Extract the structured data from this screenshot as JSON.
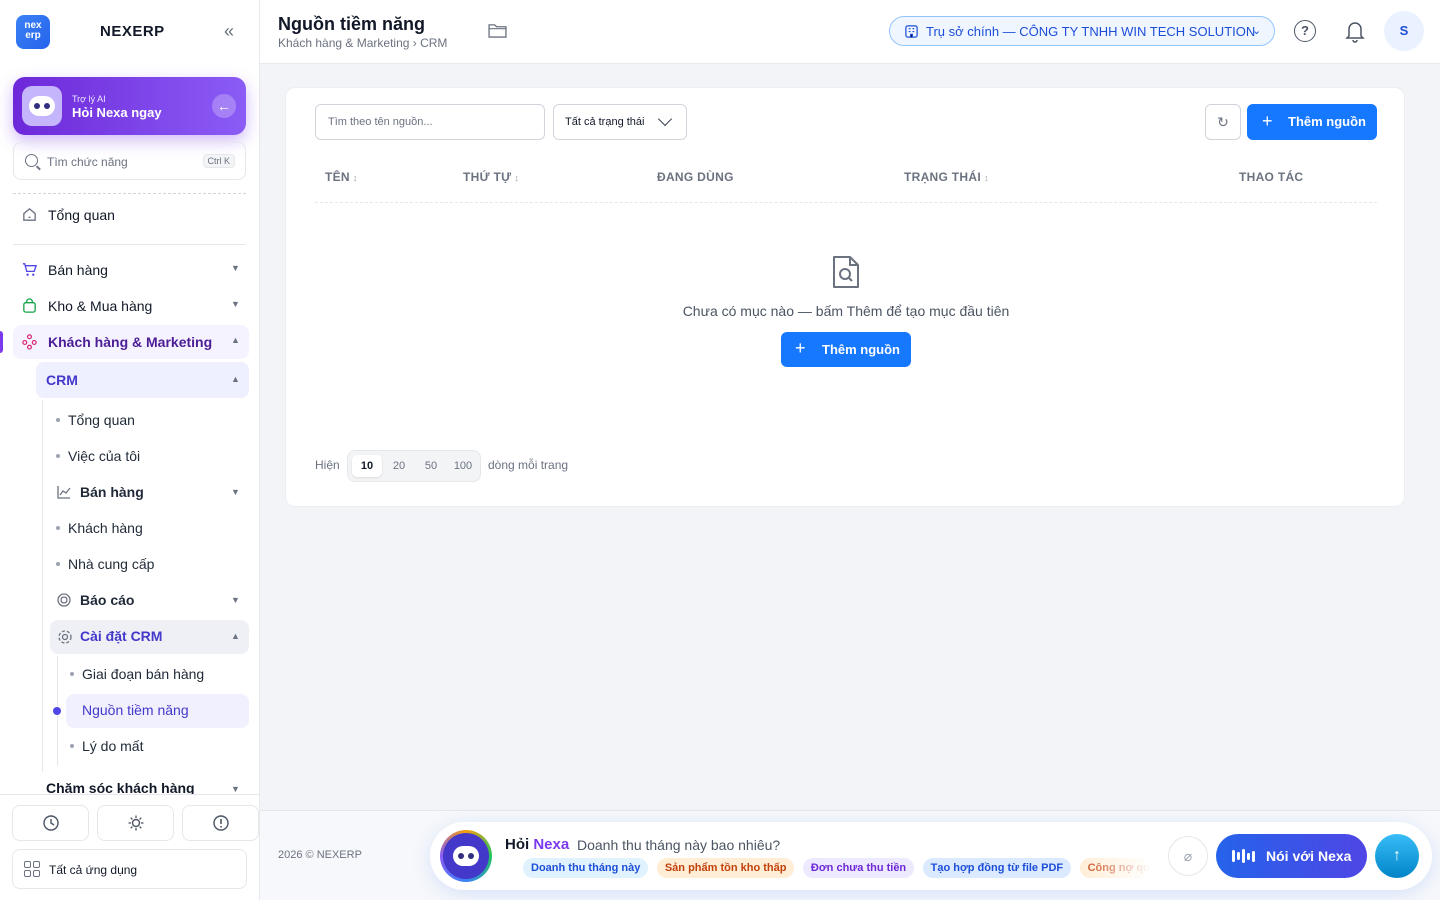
{
  "brand": {
    "logo_text": "nex erp",
    "name": "NEXERP"
  },
  "ai_card": {
    "subtitle": "Trợ lý AI",
    "title": "Hỏi Nexa ngay"
  },
  "side_search": {
    "placeholder": "Tìm chức năng",
    "shortcut": "Ctrl K"
  },
  "sidebar": {
    "overview": "Tổng quan",
    "groups": [
      {
        "label": "Bán hàng",
        "icon": "cart-icon"
      },
      {
        "label": "Kho & Mua hàng",
        "icon": "bag-icon"
      },
      {
        "label": "Khách hàng & Marketing",
        "icon": "users-network-icon"
      }
    ],
    "crm": {
      "label": "CRM",
      "items": [
        {
          "label": "Tổng quan"
        },
        {
          "label": "Việc của tôi"
        },
        {
          "label": "Bán hàng"
        },
        {
          "label": "Khách hàng"
        },
        {
          "label": "Nhà cung cấp"
        },
        {
          "label": "Báo cáo"
        },
        {
          "label": "Cài đặt CRM"
        }
      ],
      "settings_items": [
        {
          "label": "Giai đoạn bán hàng"
        },
        {
          "label": "Nguồn tiềm năng"
        },
        {
          "label": "Lý do mất"
        }
      ]
    },
    "cham_soc": "Chăm sóc khách hàng",
    "all_apps": "Tất cả ứng dụng"
  },
  "header": {
    "title": "Nguồn tiềm năng",
    "breadcrumb": "Khách hàng & Marketing › CRM",
    "company": "Trụ sở chính — CÔNG TY TNHH WIN TECH SOLUTION",
    "avatar": "S"
  },
  "toolbar": {
    "search_placeholder": "Tìm theo tên nguồn...",
    "status_filter": "Tất cả trạng thái",
    "add_label": "Thêm nguồn"
  },
  "table": {
    "columns": [
      "TÊN",
      "THỨ TỰ",
      "ĐANG DÙNG",
      "TRẠNG THÁI",
      "THAO TÁC"
    ],
    "sortable": [
      true,
      true,
      false,
      true,
      false
    ],
    "rows": []
  },
  "empty_state": {
    "message": "Chưa có mục nào — bấm Thêm để tạo mục đầu tiên",
    "button": "Thêm nguồn"
  },
  "pagination": {
    "prefix": "Hiện",
    "options": [
      "10",
      "20",
      "50",
      "100"
    ],
    "selected": "10",
    "suffix": "dòng mỗi trang"
  },
  "footer": {
    "copyright": "2026 © NEXERP"
  },
  "ask_bar": {
    "hoi": "Hỏi",
    "nexa": "Nexa",
    "placeholder": "Doanh thu tháng này bao nhiêu?",
    "chips": [
      "Doanh thu tháng này",
      "Sản phẩm tồn kho thấp",
      "Đơn chưa thu tiền",
      "Tạo hợp đồng từ file PDF",
      "Công nợ quá hạn"
    ],
    "voice_label": "Nói với Nexa"
  },
  "colors": {
    "primary": "#1677ff",
    "accent": "#7c3aed",
    "active_text": "#4338ca"
  }
}
